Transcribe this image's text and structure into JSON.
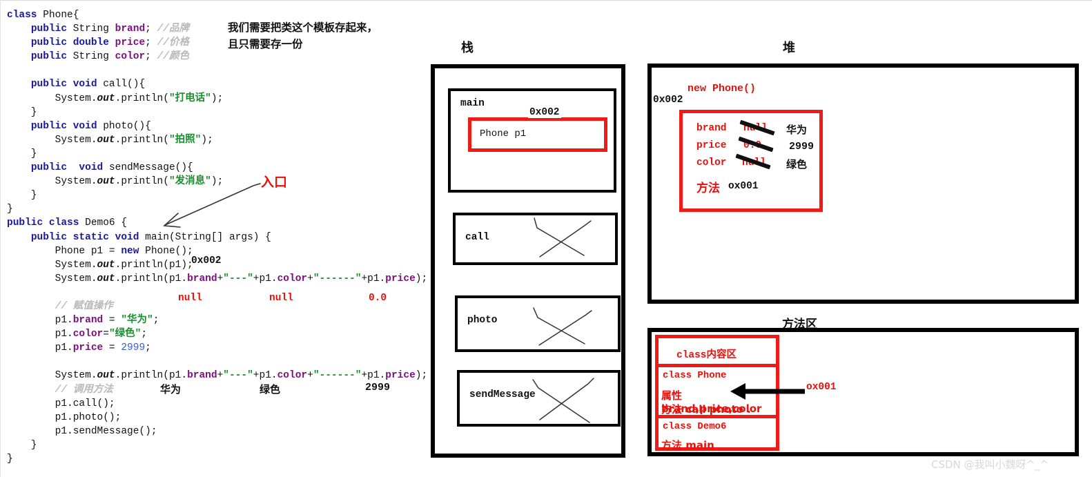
{
  "code_panel": {
    "lines": [
      [
        {
          "t": "class ",
          "c": "kw"
        },
        {
          "t": "Phone{",
          "c": "plain"
        }
      ],
      [
        {
          "t": "    ",
          "c": "plain"
        },
        {
          "t": "public ",
          "c": "kw"
        },
        {
          "t": "String ",
          "c": "plain"
        },
        {
          "t": "brand",
          "c": "fld"
        },
        {
          "t": "; ",
          "c": "plain"
        },
        {
          "t": "//品牌",
          "c": "cmt"
        }
      ],
      [
        {
          "t": "    ",
          "c": "plain"
        },
        {
          "t": "public double ",
          "c": "kw"
        },
        {
          "t": "price",
          "c": "fld"
        },
        {
          "t": "; ",
          "c": "plain"
        },
        {
          "t": "//价格",
          "c": "cmt"
        }
      ],
      [
        {
          "t": "    ",
          "c": "plain"
        },
        {
          "t": "public ",
          "c": "kw"
        },
        {
          "t": "String ",
          "c": "plain"
        },
        {
          "t": "color",
          "c": "fld"
        },
        {
          "t": "; ",
          "c": "plain"
        },
        {
          "t": "//颜色",
          "c": "cmt"
        }
      ],
      [
        {
          "t": "",
          "c": "plain"
        }
      ],
      [
        {
          "t": "    ",
          "c": "plain"
        },
        {
          "t": "public void ",
          "c": "kw"
        },
        {
          "t": "call(){",
          "c": "plain"
        }
      ],
      [
        {
          "t": "        System.",
          "c": "plain"
        },
        {
          "t": "out",
          "c": "emph"
        },
        {
          "t": ".println(",
          "c": "plain"
        },
        {
          "t": "\"打电话\"",
          "c": "str"
        },
        {
          "t": ");",
          "c": "plain"
        }
      ],
      [
        {
          "t": "    }",
          "c": "plain"
        }
      ],
      [
        {
          "t": "    ",
          "c": "plain"
        },
        {
          "t": "public void ",
          "c": "kw"
        },
        {
          "t": "photo(){",
          "c": "plain"
        }
      ],
      [
        {
          "t": "        System.",
          "c": "plain"
        },
        {
          "t": "out",
          "c": "emph"
        },
        {
          "t": ".println(",
          "c": "plain"
        },
        {
          "t": "\"拍照\"",
          "c": "str"
        },
        {
          "t": ");",
          "c": "plain"
        }
      ],
      [
        {
          "t": "    }",
          "c": "plain"
        }
      ],
      [
        {
          "t": "    ",
          "c": "plain"
        },
        {
          "t": "public  void ",
          "c": "kw"
        },
        {
          "t": "sendMessage(){",
          "c": "plain"
        }
      ],
      [
        {
          "t": "        System.",
          "c": "plain"
        },
        {
          "t": "out",
          "c": "emph"
        },
        {
          "t": ".println(",
          "c": "plain"
        },
        {
          "t": "\"发消息\"",
          "c": "str"
        },
        {
          "t": ");",
          "c": "plain"
        }
      ],
      [
        {
          "t": "    }",
          "c": "plain"
        }
      ],
      [
        {
          "t": "}",
          "c": "plain"
        }
      ],
      [
        {
          "t": "public class ",
          "c": "kw"
        },
        {
          "t": "Demo6 {",
          "c": "plain"
        }
      ],
      [
        {
          "t": "    ",
          "c": "plain"
        },
        {
          "t": "public static void ",
          "c": "kw"
        },
        {
          "t": "main(String[] args) {",
          "c": "plain"
        }
      ],
      [
        {
          "t": "        Phone p1 = ",
          "c": "plain"
        },
        {
          "t": "new ",
          "c": "kw"
        },
        {
          "t": "Phone();",
          "c": "plain"
        }
      ],
      [
        {
          "t": "        System.",
          "c": "plain"
        },
        {
          "t": "out",
          "c": "emph"
        },
        {
          "t": ".println(p1);",
          "c": "plain"
        }
      ],
      [
        {
          "t": "        System.",
          "c": "plain"
        },
        {
          "t": "out",
          "c": "emph"
        },
        {
          "t": ".println(p1.",
          "c": "plain"
        },
        {
          "t": "brand",
          "c": "fld"
        },
        {
          "t": "+",
          "c": "plain"
        },
        {
          "t": "\"---\"",
          "c": "str"
        },
        {
          "t": "+p1.",
          "c": "plain"
        },
        {
          "t": "color",
          "c": "fld"
        },
        {
          "t": "+",
          "c": "plain"
        },
        {
          "t": "\"------\"",
          "c": "str"
        },
        {
          "t": "+p1.",
          "c": "plain"
        },
        {
          "t": "price",
          "c": "fld"
        },
        {
          "t": ");",
          "c": "plain"
        }
      ],
      [
        {
          "t": "",
          "c": "plain"
        }
      ],
      [
        {
          "t": "        ",
          "c": "plain"
        },
        {
          "t": "// 赋值操作",
          "c": "cmt"
        }
      ],
      [
        {
          "t": "        p1.",
          "c": "plain"
        },
        {
          "t": "brand",
          "c": "fld"
        },
        {
          "t": " = ",
          "c": "plain"
        },
        {
          "t": "\"华为\"",
          "c": "str"
        },
        {
          "t": ";",
          "c": "plain"
        }
      ],
      [
        {
          "t": "        p1.",
          "c": "plain"
        },
        {
          "t": "color",
          "c": "fld"
        },
        {
          "t": "=",
          "c": "plain"
        },
        {
          "t": "\"绿色\"",
          "c": "str"
        },
        {
          "t": ";",
          "c": "plain"
        }
      ],
      [
        {
          "t": "        p1.",
          "c": "plain"
        },
        {
          "t": "price",
          "c": "fld"
        },
        {
          "t": " = ",
          "c": "plain"
        },
        {
          "t": "2999",
          "c": "num"
        },
        {
          "t": ";",
          "c": "plain"
        }
      ],
      [
        {
          "t": "",
          "c": "plain"
        }
      ],
      [
        {
          "t": "        System.",
          "c": "plain"
        },
        {
          "t": "out",
          "c": "emph"
        },
        {
          "t": ".println(p1.",
          "c": "plain"
        },
        {
          "t": "brand",
          "c": "fld"
        },
        {
          "t": "+",
          "c": "plain"
        },
        {
          "t": "\"---\"",
          "c": "str"
        },
        {
          "t": "+p1.",
          "c": "plain"
        },
        {
          "t": "color",
          "c": "fld"
        },
        {
          "t": "+",
          "c": "plain"
        },
        {
          "t": "\"------\"",
          "c": "str"
        },
        {
          "t": "+p1.",
          "c": "plain"
        },
        {
          "t": "price",
          "c": "fld"
        },
        {
          "t": ");",
          "c": "plain"
        }
      ],
      [
        {
          "t": "        ",
          "c": "plain"
        },
        {
          "t": "// 调用方法",
          "c": "cmt"
        }
      ],
      [
        {
          "t": "        p1.call();",
          "c": "plain"
        }
      ],
      [
        {
          "t": "        p1.photo();",
          "c": "plain"
        }
      ],
      [
        {
          "t": "        p1.sendMessage();",
          "c": "plain"
        }
      ],
      [
        {
          "t": "    }",
          "c": "plain"
        }
      ],
      [
        {
          "t": "}",
          "c": "plain"
        }
      ]
    ],
    "annotations": {
      "template_note": "我们需要把类这个模板存起来，且只需要存一份",
      "entry_label": "入口",
      "hex_main": "0x002",
      "null_brand": "null",
      "null_color": "null",
      "zero_price": "0.0",
      "out_brand": "华为",
      "out_color": "绿色",
      "out_price": "2999"
    }
  },
  "stack": {
    "title": "栈",
    "frames": [
      {
        "label": "main"
      },
      {
        "label": "call"
      },
      {
        "label": "photo"
      },
      {
        "label": "sendMessage"
      }
    ],
    "variable": {
      "declaration": "Phone p1",
      "value": "0x002"
    }
  },
  "heap": {
    "title": "堆",
    "new_label": "new Phone()",
    "address": "0x002",
    "fields": [
      {
        "key": "brand",
        "old": "null",
        "new": "华为"
      },
      {
        "key": "price",
        "old": "0.0",
        "new": "2999"
      },
      {
        "key": "color",
        "old": "null",
        "new": "绿色"
      }
    ],
    "method_key": "方法",
    "method_value": "ox001"
  },
  "method_area": {
    "title": "方法区",
    "header": "class内容区",
    "phone_class": {
      "name": "class Phone",
      "attributes": "属性 brand,price,color",
      "methods": "方法 call photo ."
    },
    "demo_class": {
      "name": "class Demo6",
      "methods": "方法  main"
    },
    "pointer_label": "ox001"
  },
  "watermark": {
    "text": "CSDN @我叫小魏呀^_^"
  },
  "colors": {
    "keyword": "#1a1a9c",
    "field": "#7b0f7b",
    "comment": "#b9b9b9",
    "string": "#1a8f2e",
    "number": "#3b5bdb",
    "accent_red": "#ee1b16",
    "text": "#111111"
  }
}
